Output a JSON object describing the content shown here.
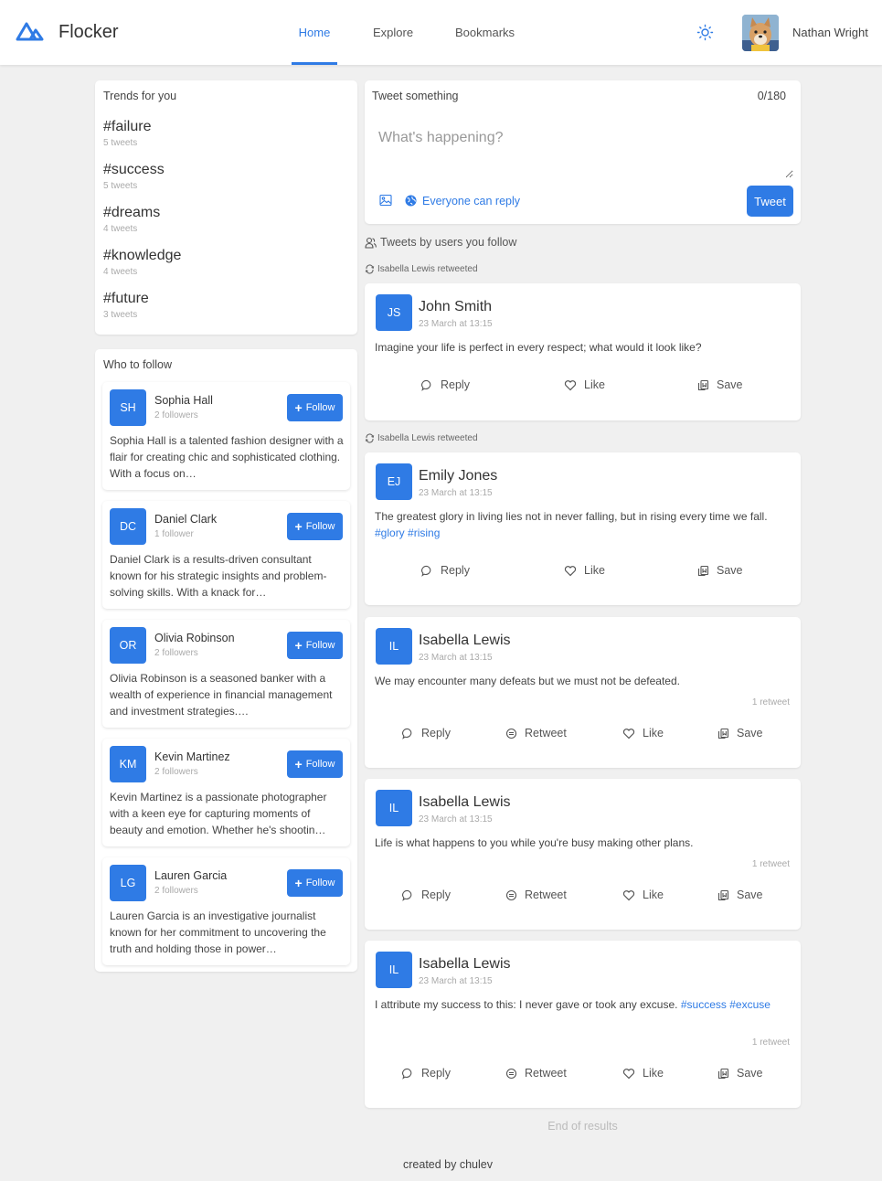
{
  "app": {
    "name": "Flocker"
  },
  "nav": {
    "home": "Home",
    "explore": "Explore",
    "bookmarks": "Bookmarks"
  },
  "user": {
    "name": "Nathan Wright"
  },
  "trends": {
    "title": "Trends for you",
    "items": [
      {
        "tag": "#failure",
        "count": "5 tweets"
      },
      {
        "tag": "#success",
        "count": "5 tweets"
      },
      {
        "tag": "#dreams",
        "count": "4 tweets"
      },
      {
        "tag": "#knowledge",
        "count": "4 tweets"
      },
      {
        "tag": "#future",
        "count": "3 tweets"
      }
    ]
  },
  "who_to_follow": {
    "title": "Who to follow",
    "follow_label": "Follow",
    "people": [
      {
        "initials": "SH",
        "name": "Sophia Hall",
        "followers": "2 followers",
        "bio": "Sophia Hall is a talented fashion designer with a flair for creating chic and sophisticated clothing. With a focus on…"
      },
      {
        "initials": "DC",
        "name": "Daniel Clark",
        "followers": "1 follower",
        "bio": "Daniel Clark is a results-driven consultant known for his strategic insights and problem-solving skills. With a knack for…"
      },
      {
        "initials": "OR",
        "name": "Olivia Robinson",
        "followers": "2 followers",
        "bio": "Olivia Robinson is a seasoned banker with a wealth of experience in financial management and investment strategies.…"
      },
      {
        "initials": "KM",
        "name": "Kevin Martinez",
        "followers": "2 followers",
        "bio": "Kevin Martinez is a passionate photographer with a keen eye for capturing moments of beauty and emotion. Whether he's shootin…"
      },
      {
        "initials": "LG",
        "name": "Lauren Garcia",
        "followers": "2 followers",
        "bio": "Lauren Garcia is an investigative journalist known for her commitment to uncovering the truth and holding those in power…"
      }
    ]
  },
  "compose": {
    "title": "Tweet something",
    "char_count": "0/180",
    "placeholder": "What's happening?",
    "audience": "Everyone can reply",
    "tweet_button": "Tweet"
  },
  "feed": {
    "section_label": "Tweets by users you follow",
    "actions": {
      "reply": "Reply",
      "retweet": "Retweet",
      "like": "Like",
      "save": "Save"
    },
    "tweets": [
      {
        "retweeted_by": "Isabella Lewis retweeted",
        "initials": "JS",
        "author": "John Smith",
        "date": "23 March at 13:15",
        "text": "Imagine your life is perfect in every respect; what would it look like?"
      },
      {
        "retweeted_by": "Isabella Lewis retweeted",
        "initials": "EJ",
        "author": "Emily Jones",
        "date": "23 March at 13:15",
        "text": "The greatest glory in living lies not in never falling, but in rising every time we fall.",
        "hashtags": [
          "#glory",
          "#rising"
        ]
      },
      {
        "initials": "IL",
        "author": "Isabella Lewis",
        "date": "23 March at 13:15",
        "text": "We may encounter many defeats but we must not be defeated.",
        "retweets": "1 retweet"
      },
      {
        "initials": "IL",
        "author": "Isabella Lewis",
        "date": "23 March at 13:15",
        "text": "Life is what happens to you while you're busy making other plans.",
        "retweets": "1 retweet"
      },
      {
        "initials": "IL",
        "author": "Isabella Lewis",
        "date": "23 March at 13:15",
        "text": "I attribute my success to this: I never gave or took any excuse.",
        "hashtags": [
          "#success",
          "#excuse"
        ],
        "retweets": "1 retweet"
      }
    ],
    "end_text": "End of results"
  },
  "footer": {
    "credit": "created by chulev"
  },
  "colors": {
    "accent": "#2f7be5",
    "background": "#f0f0f0"
  }
}
